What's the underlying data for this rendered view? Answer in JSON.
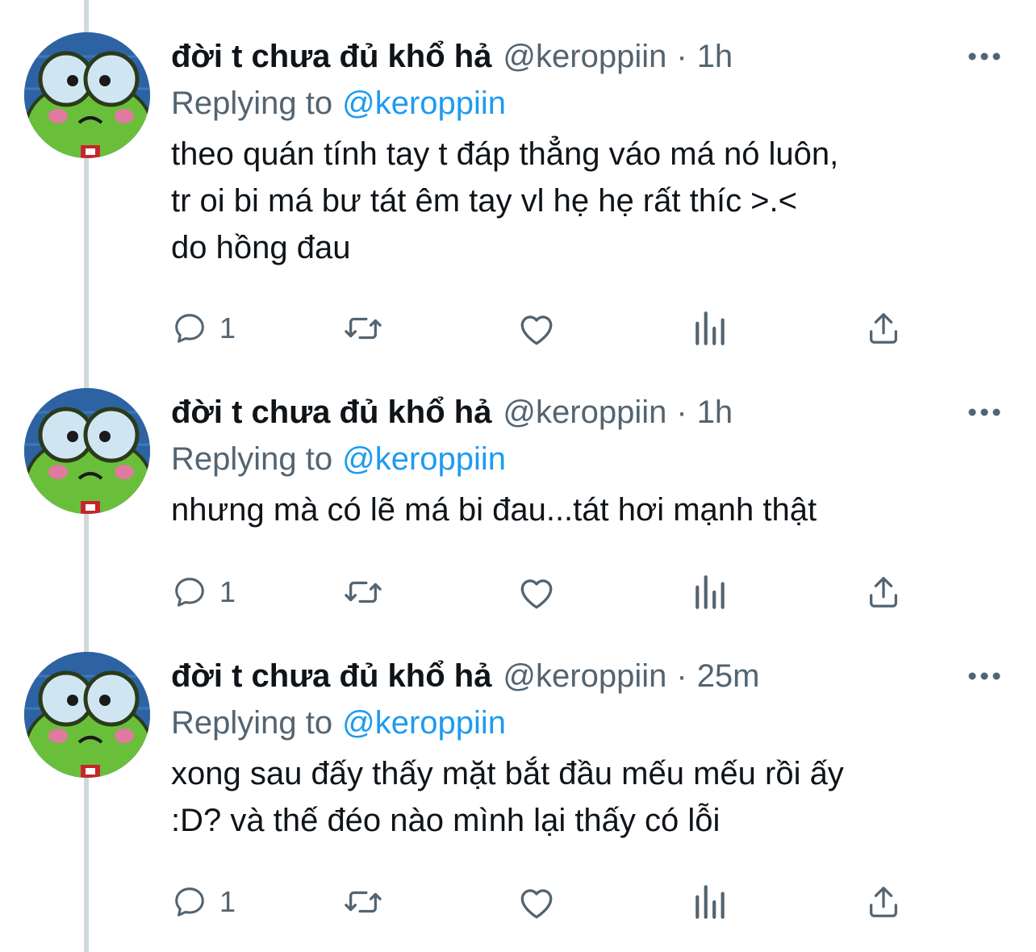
{
  "tweets": [
    {
      "name": "đời t chưa đủ khổ hả",
      "handle": "@keroppiin",
      "dot": "·",
      "time": "1h",
      "replying_label": "Replying to",
      "replying_to": "@keroppiin",
      "lines": [
        "theo quán tính tay t đáp thẳng váo má nó luôn,",
        "tr oi bi má bư tát êm tay vl hẹ hẹ rất thíc >.<",
        "do hồng đau"
      ],
      "reply_count": "1"
    },
    {
      "name": "đời t chưa đủ khổ hả",
      "handle": "@keroppiin",
      "dot": "·",
      "time": "1h",
      "replying_label": "Replying to",
      "replying_to": "@keroppiin",
      "lines": [
        "nhưng mà có lẽ má bi đau...tát hơi mạnh thật"
      ],
      "reply_count": "1"
    },
    {
      "name": "đời t chưa đủ khổ hả",
      "handle": "@keroppiin",
      "dot": "·",
      "time": "25m",
      "replying_label": "Replying to",
      "replying_to": "@keroppiin",
      "lines": [
        "xong sau đấy thấy mặt bắt đầu mếu mếu rồi ấy",
        ":D? và thế đéo nào mình lại thấy có lỗi"
      ],
      "reply_count": "1"
    }
  ],
  "icons": {
    "more": "more-dots-icon",
    "reply": "reply-bubble-icon",
    "retweet": "retweet-icon",
    "like": "heart-icon",
    "analytics": "analytics-icon",
    "share": "share-icon"
  },
  "colors": {
    "text": "#0f1419",
    "secondary": "#536471",
    "link": "#1d9bf0",
    "thread_line": "#cfd9de"
  }
}
